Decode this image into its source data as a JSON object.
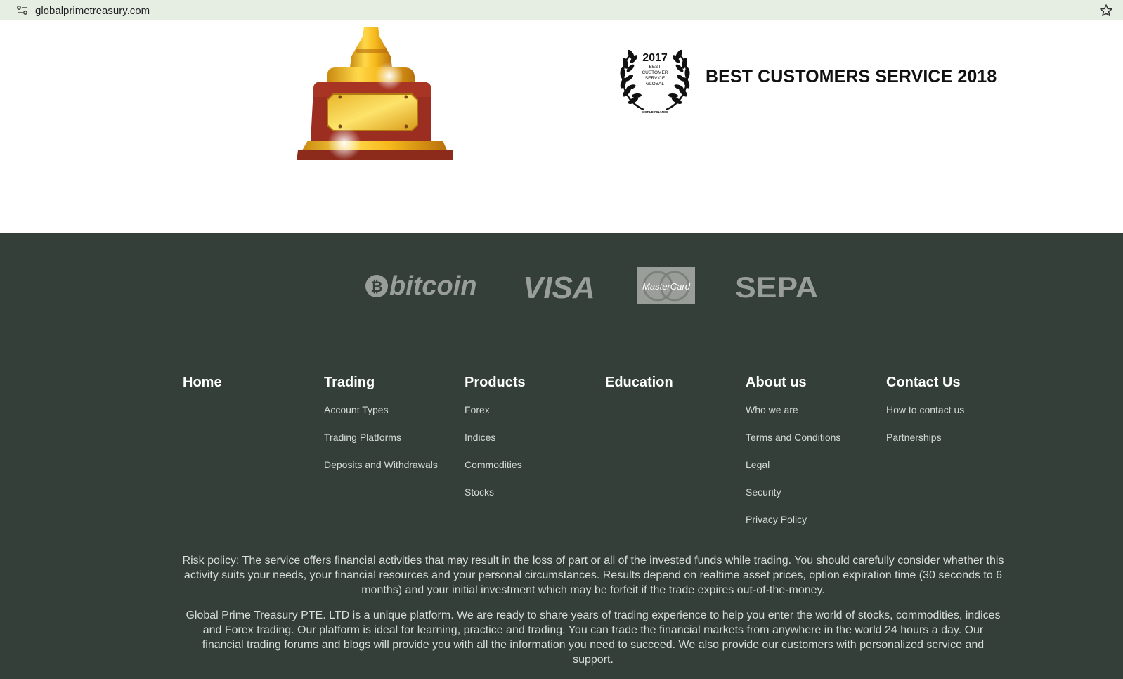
{
  "browser": {
    "url": "globalprimetreasury.com",
    "site_settings_icon": "tune-icon",
    "bookmark_icon": "star-icon"
  },
  "awards": {
    "trophy_icon": "trophy-icon",
    "laurel": {
      "year": "2017",
      "line1": "BEST",
      "line2": "CUSTOMER",
      "line3": "SERVICE",
      "line4": "GLOBAL",
      "issuer": "WORLD FINANCE"
    },
    "title": "BEST CUSTOMERS SERVICE 2018"
  },
  "payments": {
    "bitcoin": "bitcoin",
    "visa": "VISA",
    "mastercard": "MasterCard",
    "sepa": "SEPA"
  },
  "footer_nav": {
    "home": {
      "title": "Home",
      "links": []
    },
    "trading": {
      "title": "Trading",
      "links": [
        "Account Types",
        "Trading Platforms",
        "Deposits and Withdrawals"
      ]
    },
    "products": {
      "title": "Products",
      "links": [
        "Forex",
        "Indices",
        "Commodities",
        "Stocks"
      ]
    },
    "education": {
      "title": "Education",
      "links": []
    },
    "about": {
      "title": "About us",
      "links": [
        "Who we are",
        "Terms and Conditions",
        "Legal",
        "Security",
        "Privacy Policy"
      ]
    },
    "contact": {
      "title": "Contact Us",
      "links": [
        "How to contact us",
        "Partnerships"
      ]
    }
  },
  "disclaimer": {
    "risk_policy": "Risk policy: The service offers financial activities that may result in the loss of part or all of the invested funds while trading. You should carefully consider whether this activity suits your needs, your financial resources and your personal circumstances. Results depend on realtime asset prices, option expiration time (30 seconds to 6 months) and your initial investment which may be forfeit if the trade expires out-of-the-money.",
    "about_text": "Global Prime Treasury PTE. LTD is a unique platform. We are ready to share years of trading experience to help you enter the world of stocks, commodities, indices and Forex trading. Our platform is ideal for learning, practice and trading. You can trade the financial markets from anywhere in the world 24 hours a day. Our financial trading forums and blogs will provide you with all the information you need to succeed. We also provide our customers with personalized service and support."
  }
}
